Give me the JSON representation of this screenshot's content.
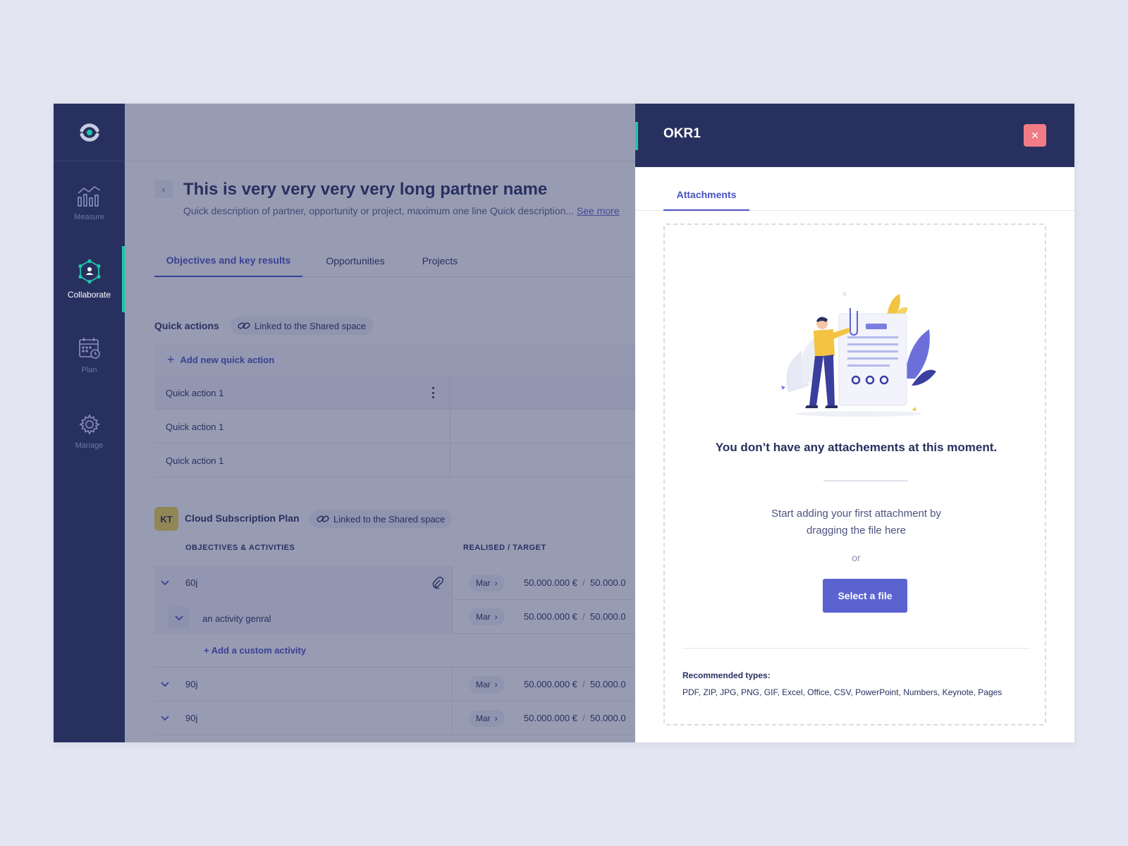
{
  "sidebar": {
    "items": [
      {
        "label": "Measure",
        "icon": "chart-icon"
      },
      {
        "label": "Collaborate",
        "icon": "collaborate-icon"
      },
      {
        "label": "Plan",
        "icon": "calendar-icon"
      },
      {
        "label": "Manage",
        "icon": "gear-icon"
      }
    ],
    "active": "Collaborate"
  },
  "main": {
    "title": "This is very very very very long partner name",
    "description": "Quick description of partner, opportunity or project, maximum one line Quick description...",
    "see_more": "See more",
    "tabs": [
      {
        "label": "Objectives and key results",
        "active": true
      },
      {
        "label": "Opportunities",
        "active": false
      },
      {
        "label": "Projects",
        "active": false
      }
    ],
    "quick_actions": {
      "label": "Quick actions",
      "linked": "Linked to the Shared space",
      "add_label": "Add new quick action",
      "rows": [
        "Quick action 1",
        "Quick action 1",
        "Quick action 1"
      ]
    },
    "plan": {
      "badge": "KT",
      "name": "Cloud Subscription Plan",
      "linked": "Linked to the Shared space",
      "col_objectives": "OBJECTIVES & ACTIVITIES",
      "col_realised": "REALISED / TARGET",
      "rows": [
        {
          "name": "60j",
          "month": "Mar",
          "realised": "50.000.000 €",
          "sep": "/",
          "target": "50.000.0"
        },
        {
          "name": "an activity genral",
          "month": "Mar",
          "realised": "50.000.000 €",
          "sep": "/",
          "target": "50.000.0"
        },
        {
          "name": "90j",
          "month": "Mar",
          "realised": "50.000.000 €",
          "sep": "/",
          "target": "50.000.0"
        },
        {
          "name": "90j",
          "month": "Mar",
          "realised": "50.000.000 €",
          "sep": "/",
          "target": "50.000.0"
        }
      ],
      "add_custom": "+ Add a custom activity"
    }
  },
  "panel": {
    "title": "OKR1",
    "close_icon": "close-icon",
    "tab": "Attachments",
    "empty_title": "You don’t have any attachements at this moment.",
    "hint_line1": "Start adding your first attachment by",
    "hint_line2": "dragging the file here",
    "or": "or",
    "select_button": "Select a file",
    "recommended_label": "Recommended types:",
    "recommended_types": "PDF, ZIP, JPG, PNG, GIF, Excel, Office, CSV, PowerPoint, Numbers, Keynote, Pages"
  },
  "colors": {
    "navy": "#283060",
    "accent": "#4950c4",
    "teal": "#1fc8a8",
    "close": "#f27c86",
    "button": "#5a63d0",
    "yellow": "#f1d64b"
  }
}
